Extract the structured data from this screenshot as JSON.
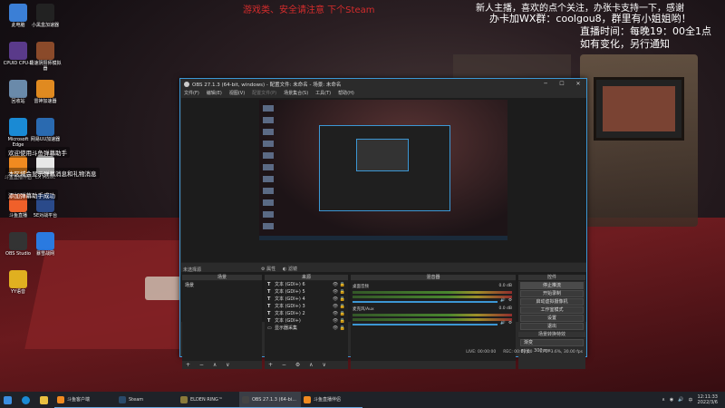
{
  "overlay": {
    "red_banner": "游戏类、安全请注意    下个Steam",
    "line1": "新人主播，喜欢的点个关注，办张卡支持一下，感谢",
    "line2": "办卡加WX群：coolgou8，群里有小姐姐哟！",
    "line3": "直播时间：每晚19：00全1点",
    "line4": "如有变化，另行通知"
  },
  "desktop_icons": [
    {
      "label": "此电脑",
      "icon": "computer-icon",
      "color": "#3b7fd6"
    },
    {
      "label": "小黑盒加速器",
      "icon": "xiaoheihe-icon",
      "color": "#222222"
    },
    {
      "label": "CPUID CPU-Z",
      "icon": "cpuz-icon",
      "color": "#5a3a8a"
    },
    {
      "label": "极速阴阳师模拟器",
      "icon": "game-icon",
      "color": "#8a4a2a"
    },
    {
      "label": "回收站",
      "icon": "recycle-bin-icon",
      "color": "#6a8aaa"
    },
    {
      "label": "雷神加速器",
      "icon": "leishen-icon",
      "color": "#e08a20"
    },
    {
      "label": "Microsoft Edge",
      "icon": "edge-icon",
      "color": "#1a8ad4"
    },
    {
      "label": "网易UU加速器",
      "icon": "uu-icon",
      "color": "#2a6ab0"
    },
    {
      "label": "斗鱼直播伴侣",
      "icon": "douyu-icon",
      "color": "#f08a20"
    },
    {
      "label": "LX Music",
      "icon": "lxmusic-icon",
      "color": "#e8e8e8"
    },
    {
      "label": "斗鱼直播",
      "icon": "douyu-live-icon",
      "color": "#f0602a"
    },
    {
      "label": "5E对战平台",
      "icon": "5e-icon",
      "color": "#2a4a8a"
    },
    {
      "label": "OBS Studio",
      "icon": "obs-icon",
      "color": "#333333"
    },
    {
      "label": "暴雪战网",
      "icon": "battlenet-icon",
      "color": "#2a7ae0"
    },
    {
      "label": "YY语音",
      "icon": "yy-icon",
      "color": "#e0b020"
    }
  ],
  "notifications": [
    "欢迎使用斗鱼弹幕助手",
    "本区域会显示弹幕消息和礼物消息",
    "添加弹幕助手成功"
  ],
  "obs": {
    "title": "OBS 27.1.3 (64-bit, windows) - 配置文件: 未命名 - 场景: 未命名",
    "menu": [
      "文件(F)",
      "编辑(E)",
      "视图(V)",
      "配置文件(P)",
      "场景集合(S)",
      "工具(T)",
      "帮助(H)"
    ],
    "no_source": "未选择源",
    "props_btn": "属性",
    "filters_btn": "滤镜",
    "docks": {
      "scenes": "场景",
      "sources": "来源",
      "mixer": "混音器",
      "transitions": "场景转换特效",
      "controls": "控件"
    },
    "scenes": [
      "场景"
    ],
    "sources": [
      "文本 (GDI+) 6",
      "文本 (GDI+) 5",
      "文本 (GDI+) 4",
      "文本 (GDI+) 3",
      "文本 (GDI+) 2",
      "文本 (GDI+)",
      "显示器采集"
    ],
    "mixer": [
      {
        "name": "桌面音频",
        "db": "0.0 dB"
      },
      {
        "name": "麦克风/Aux",
        "db": "0.0 dB"
      }
    ],
    "controls": [
      "停止推流",
      "开始录制",
      "启动虚拟摄像机",
      "工作室模式",
      "设置",
      "退出"
    ],
    "transition": {
      "type": "渐变",
      "duration_label": "时长",
      "duration": "300 ms"
    },
    "status": {
      "live": "LIVE: 00:00:00",
      "rec": "REC: 00:00:00",
      "cpu": "CPU: 3.6%, 30.00 fps"
    },
    "foot": "+ − ∧ ∨"
  },
  "taskbar": {
    "items": [
      {
        "label": "斗鱼客户端",
        "color": "#f08a20"
      },
      {
        "label": "Steam",
        "color": "#2a4a6a"
      },
      {
        "label": "ELDEN RING™",
        "color": "#8a7a3a"
      },
      {
        "label": "OBS 27.1.3 (64-bi...",
        "color": "#444444",
        "active": true
      },
      {
        "label": "斗鱼直播伴侣",
        "color": "#f08a20"
      }
    ],
    "time": "12:11:33",
    "date": "2022/3/6"
  }
}
